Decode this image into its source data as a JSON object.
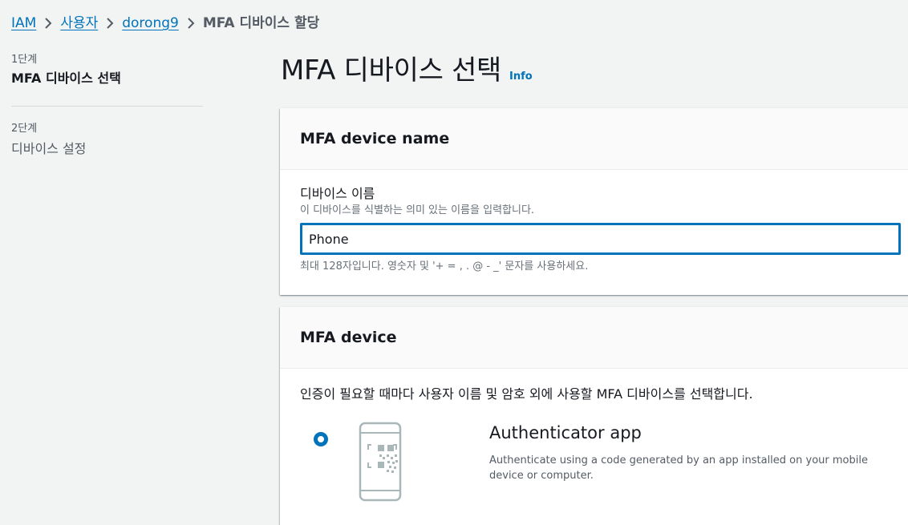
{
  "breadcrumb": {
    "items": [
      "IAM",
      "사용자",
      "dorong9"
    ],
    "current": "MFA 디바이스 할당"
  },
  "steps": [
    {
      "label": "1단계",
      "title": "MFA 디바이스 선택",
      "active": true
    },
    {
      "label": "2단계",
      "title": "디바이스 설정",
      "active": false
    }
  ],
  "page": {
    "title": "MFA 디바이스 선택",
    "info_link": "Info"
  },
  "device_name_panel": {
    "title": "MFA device name",
    "field_label": "디바이스 이름",
    "field_description": "이 디바이스를 식별하는 의미 있는 이름을 입력합니다.",
    "input_value": "Phone",
    "constraint": "최대 128자입니다. 영숫자 및 '+ = , . @ - _' 문자를 사용하세요."
  },
  "device_panel": {
    "title": "MFA device",
    "intro": "인증이 필요할 때마다 사용자 이름 및 암호 외에 사용할 MFA 디바이스를 선택합니다.",
    "options": [
      {
        "title": "Authenticator app",
        "description": "Authenticate using a code generated by an app installed on your mobile device or computer.",
        "selected": true,
        "icon": "phone-qr-icon"
      }
    ]
  },
  "colors": {
    "link": "#0073bb",
    "background": "#f2f3f3",
    "panel_header": "#fafafa",
    "text": "#16191f",
    "muted": "#687078"
  }
}
